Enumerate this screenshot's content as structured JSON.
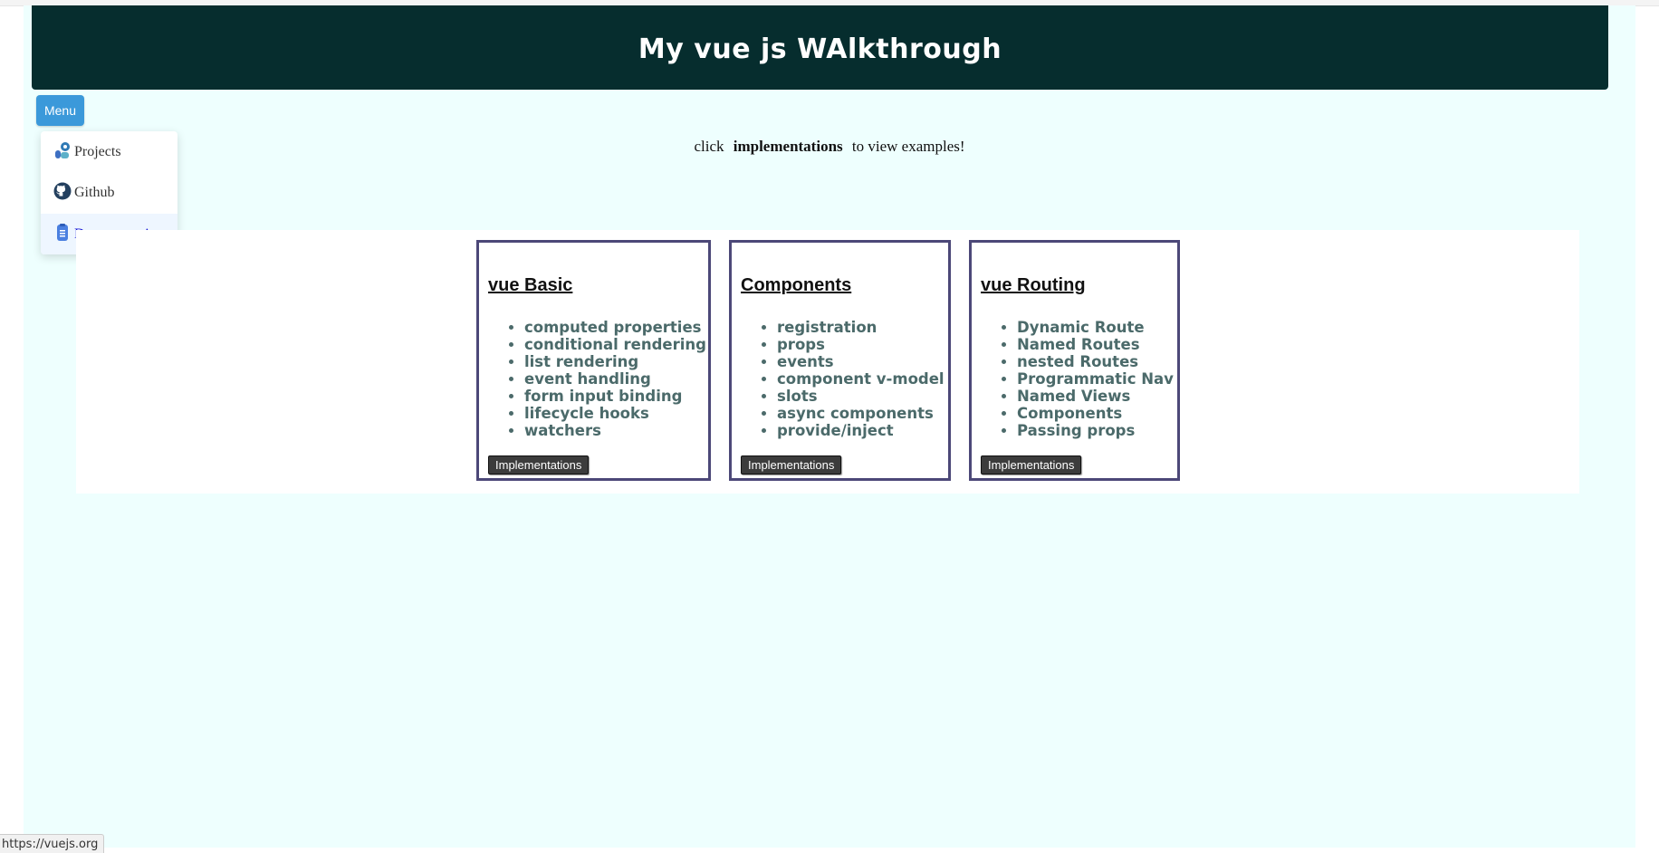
{
  "header": {
    "title": "My vue js WAlkthrough"
  },
  "menu": {
    "button_label": "Menu",
    "items": [
      {
        "label": "Projects",
        "icon": "projects-icon"
      },
      {
        "label": "Github",
        "icon": "github-icon"
      },
      {
        "label": "Documentation",
        "icon": "document-icon"
      }
    ]
  },
  "instruction": {
    "before": "click",
    "emphasis": "implementations",
    "after": "to view examples!"
  },
  "cards": [
    {
      "title": "vue Basic",
      "items": [
        "computed properties",
        "conditional rendering",
        "list rendering",
        "event handling",
        "form input binding",
        "lifecycle hooks",
        "watchers"
      ],
      "button_label": "Implementations"
    },
    {
      "title": "Components",
      "items": [
        "registration",
        "props",
        "events",
        "component v-model",
        "slots",
        "async components",
        "provide/inject"
      ],
      "button_label": "Implementations"
    },
    {
      "title": "vue Routing",
      "items": [
        "Dynamic Route",
        "Named Routes",
        "nested Routes",
        "Programmatic Nav",
        "Named Views",
        "Components",
        "Passing props"
      ],
      "button_label": "Implementations"
    }
  ],
  "status_bar": {
    "url": "https://vuejs.org"
  },
  "colors": {
    "header_bg": "#062d2e",
    "app_bg": "#eefffe",
    "menu_button": "#3b99da",
    "card_border": "#4c4878",
    "list_text": "#4b6a6a",
    "active_link": "#1515d6"
  }
}
